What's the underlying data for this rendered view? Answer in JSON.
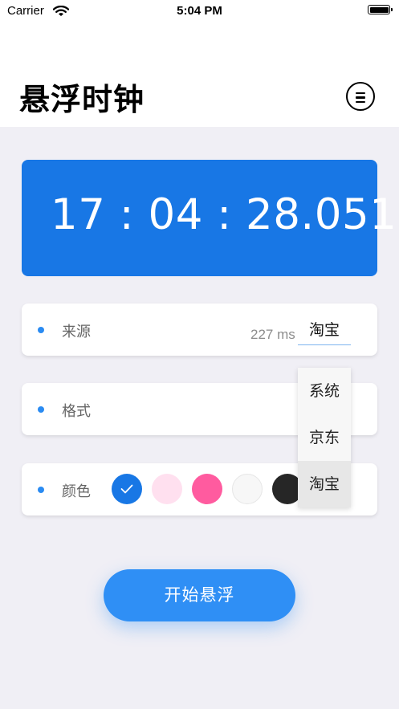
{
  "status_bar": {
    "carrier": "Carrier",
    "time": "5:04 PM"
  },
  "header": {
    "title": "悬浮时钟"
  },
  "clock": {
    "display": "17 : 04 : 28.051"
  },
  "source_row": {
    "label": "来源",
    "latency": "227 ms",
    "value": "淘宝"
  },
  "format_row": {
    "label": "格式"
  },
  "color_row": {
    "label": "颜色",
    "swatches": [
      "#1877e5",
      "#ffe0ef",
      "#ff5b9f",
      "#f7f7f7",
      "#262626",
      "#c7c7c7"
    ],
    "selected_index": 0
  },
  "source_dropdown": {
    "options": [
      "系统",
      "京东",
      "淘宝"
    ],
    "selected": "淘宝"
  },
  "start_button": {
    "label": "开始悬浮"
  },
  "colors": {
    "accent": "#1877e5",
    "button": "#2f8ff5",
    "background": "#f0eff5"
  }
}
